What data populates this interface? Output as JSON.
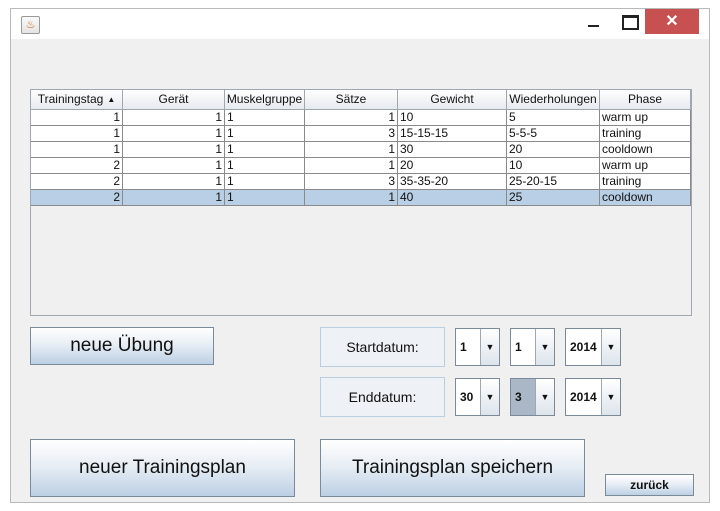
{
  "window": {
    "app_icon": "java-coffee-cup-icon",
    "minimize_icon": "minimize-icon",
    "maximize_icon": "maximize-icon",
    "close_label": "✕"
  },
  "table": {
    "columns": [
      "Trainingstag",
      "Gerät",
      "Muskelgruppe",
      "Sätze",
      "Gewicht",
      "Wiederholungen",
      "Phase"
    ],
    "sort_column": "Trainingstag",
    "sort_icon": "sort-ascending-icon",
    "rows": [
      [
        "1",
        "1",
        "1",
        "1",
        "10",
        "5",
        "warm up"
      ],
      [
        "1",
        "1",
        "1",
        "3",
        "15-15-15",
        "5-5-5",
        "training"
      ],
      [
        "1",
        "1",
        "1",
        "1",
        "30",
        "20",
        "cooldown"
      ],
      [
        "2",
        "1",
        "1",
        "1",
        "20",
        "10",
        "warm up"
      ],
      [
        "2",
        "1",
        "1",
        "3",
        "35-35-20",
        "25-20-15",
        "training"
      ],
      [
        "2",
        "1",
        "1",
        "1",
        "40",
        "25",
        "cooldown"
      ]
    ],
    "selected_row": 5,
    "selection_color": "#b8cfe5"
  },
  "buttons": {
    "neue_uebung": "neue Übung",
    "neuer_trainingsplan": "neuer Trainingsplan",
    "trainingsplan_speichern": "Trainingsplan speichern",
    "zurueck": "zurück"
  },
  "start": {
    "label": "Startdatum:",
    "day": "1",
    "month": "1",
    "year": "2014"
  },
  "end": {
    "label": "Enddatum:",
    "day": "30",
    "month": "3",
    "year": "2014"
  },
  "colors": {
    "close_button": "#c75050",
    "button_gradient_bottom": "#bcd0e4"
  }
}
